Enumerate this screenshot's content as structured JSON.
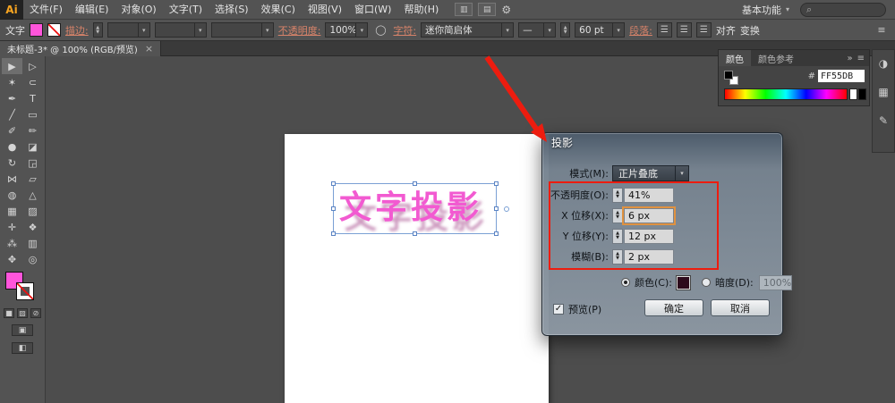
{
  "colors": {
    "fill_pink": "#ff55db",
    "text_pink": "#f25ad1",
    "annotation_red": "#ed1c0f",
    "selection_blue": "#7aa0d4",
    "highlight_orange": "#e09240",
    "shadow_swatch": "#2d0a1c"
  },
  "icons": {
    "chevron_down": "▾",
    "up": "▲",
    "down": "▼",
    "search": "⌕",
    "menu": "≡",
    "circle": "◯",
    "align": "☰",
    "check": "✓",
    "arrange_docs": "▥",
    "layout": "▤",
    "gear": "⚙",
    "fill_mini": "■",
    "gradient_mini": "▨",
    "none_mini": "⊘",
    "draw_mode": "▣",
    "screen_mode": "◧",
    "dock_color": "◑",
    "dock_swatches": "▦",
    "dock_brushes": "✎",
    "collapse": "»"
  },
  "menubar": {
    "logo": "Ai",
    "items": [
      "文件(F)",
      "编辑(E)",
      "对象(O)",
      "文字(T)",
      "选择(S)",
      "效果(C)",
      "视图(V)",
      "窗口(W)",
      "帮助(H)"
    ],
    "workspace": "基本功能",
    "search_placeholder": ""
  },
  "controlbar": {
    "object_label": "文字",
    "stroke_label": "描边:",
    "opacity_label": "不透明度:",
    "opacity_value": "100%",
    "char_label": "字符:",
    "font_name": "迷你简启体",
    "font_style": "—",
    "font_size": "60 pt",
    "paragraph_label": "段落:",
    "align_panel_label": "对齐",
    "transform_label": "变换"
  },
  "tabbar": {
    "doc_title": "未标题-3* @ 100% (RGB/预览)",
    "close": "×"
  },
  "tools": [
    {
      "name": "selection",
      "glyph": "▶"
    },
    {
      "name": "direct-selection",
      "glyph": "▷"
    },
    {
      "name": "magic-wand",
      "glyph": "✶"
    },
    {
      "name": "lasso",
      "glyph": "⊂"
    },
    {
      "name": "pen",
      "glyph": "✒"
    },
    {
      "name": "type",
      "glyph": "T"
    },
    {
      "name": "line-segment",
      "glyph": "╱"
    },
    {
      "name": "rectangle",
      "glyph": "▭"
    },
    {
      "name": "paintbrush",
      "glyph": "✐"
    },
    {
      "name": "pencil",
      "glyph": "✏"
    },
    {
      "name": "blob-brush",
      "glyph": "●"
    },
    {
      "name": "eraser",
      "glyph": "◪"
    },
    {
      "name": "rotate",
      "glyph": "↻"
    },
    {
      "name": "scale",
      "glyph": "◲"
    },
    {
      "name": "width",
      "glyph": "⋈"
    },
    {
      "name": "free-transform",
      "glyph": "▱"
    },
    {
      "name": "shape-builder",
      "glyph": "◍"
    },
    {
      "name": "perspective-grid",
      "glyph": "△"
    },
    {
      "name": "mesh",
      "glyph": "▦"
    },
    {
      "name": "gradient",
      "glyph": "▨"
    },
    {
      "name": "eyedropper",
      "glyph": "✛"
    },
    {
      "name": "blend",
      "glyph": "❖"
    },
    {
      "name": "symbol-sprayer",
      "glyph": "⁂"
    },
    {
      "name": "column-graph",
      "glyph": "▥"
    },
    {
      "name": "hand",
      "glyph": "✥"
    },
    {
      "name": "zoom",
      "glyph": "◎"
    }
  ],
  "canvas": {
    "text": "文字投影"
  },
  "dialog": {
    "title": "投影",
    "mode_label": "模式(M):",
    "mode_value": "正片叠底",
    "fields": [
      {
        "label": "不透明度(O):",
        "value": "41%"
      },
      {
        "label": "X 位移(X):",
        "value": "6 px"
      },
      {
        "label": "Y 位移(Y):",
        "value": "12 px"
      },
      {
        "label": "模糊(B):",
        "value": "2 px"
      }
    ],
    "color_label": "颜色(C):",
    "darkness_label": "暗度(D):",
    "darkness_value": "100%",
    "preview_label": "预览(P)",
    "ok": "确定",
    "cancel": "取消"
  },
  "color_panel": {
    "tab_color": "颜色",
    "tab_guide": "颜色参考",
    "hex_prefix": "#",
    "hex_value": "FF55DB"
  }
}
